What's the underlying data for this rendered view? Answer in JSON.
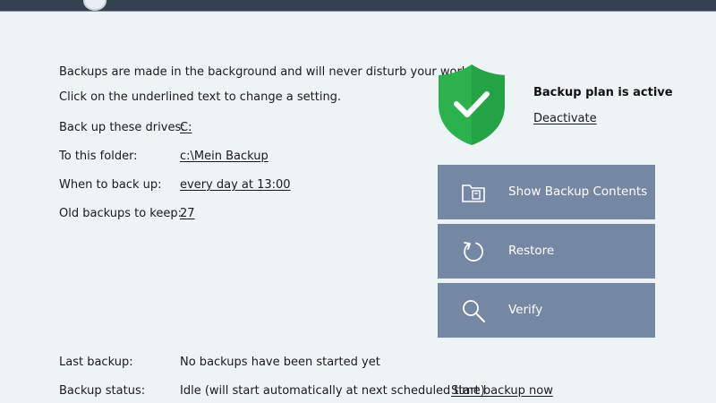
{
  "intro": {
    "line1": "Backups are made in the background and will never disturb your work.",
    "line2": "Click on the underlined text to change a setting."
  },
  "settings": [
    {
      "label": "Back up these drives:",
      "value": "C:"
    },
    {
      "label": "To this folder:",
      "value": "c:\\Mein Backup"
    },
    {
      "label": "When to back up:",
      "value": "every day at 13:00"
    },
    {
      "label": "Old backups to keep:",
      "value": "27"
    }
  ],
  "plan": {
    "status": "Backup plan is active",
    "deactivate_label": "Deactivate"
  },
  "actions": {
    "show_contents": "Show Backup Contents",
    "restore": "Restore",
    "verify": "Verify"
  },
  "footer": {
    "last_backup_label": "Last backup:",
    "last_backup_value": "No backups have been started yet",
    "status_label": "Backup status:",
    "status_value": "Idle (will start automatically at next scheduled time)",
    "start_now_label": "Start backup now"
  },
  "colors": {
    "shield": "#2bb24c",
    "button": "#7487a3",
    "background": "#eef3f6"
  },
  "icons": {
    "shield": "shield-check-icon",
    "show_contents": "folder-icon",
    "restore": "restore-icon",
    "verify": "search-icon"
  }
}
